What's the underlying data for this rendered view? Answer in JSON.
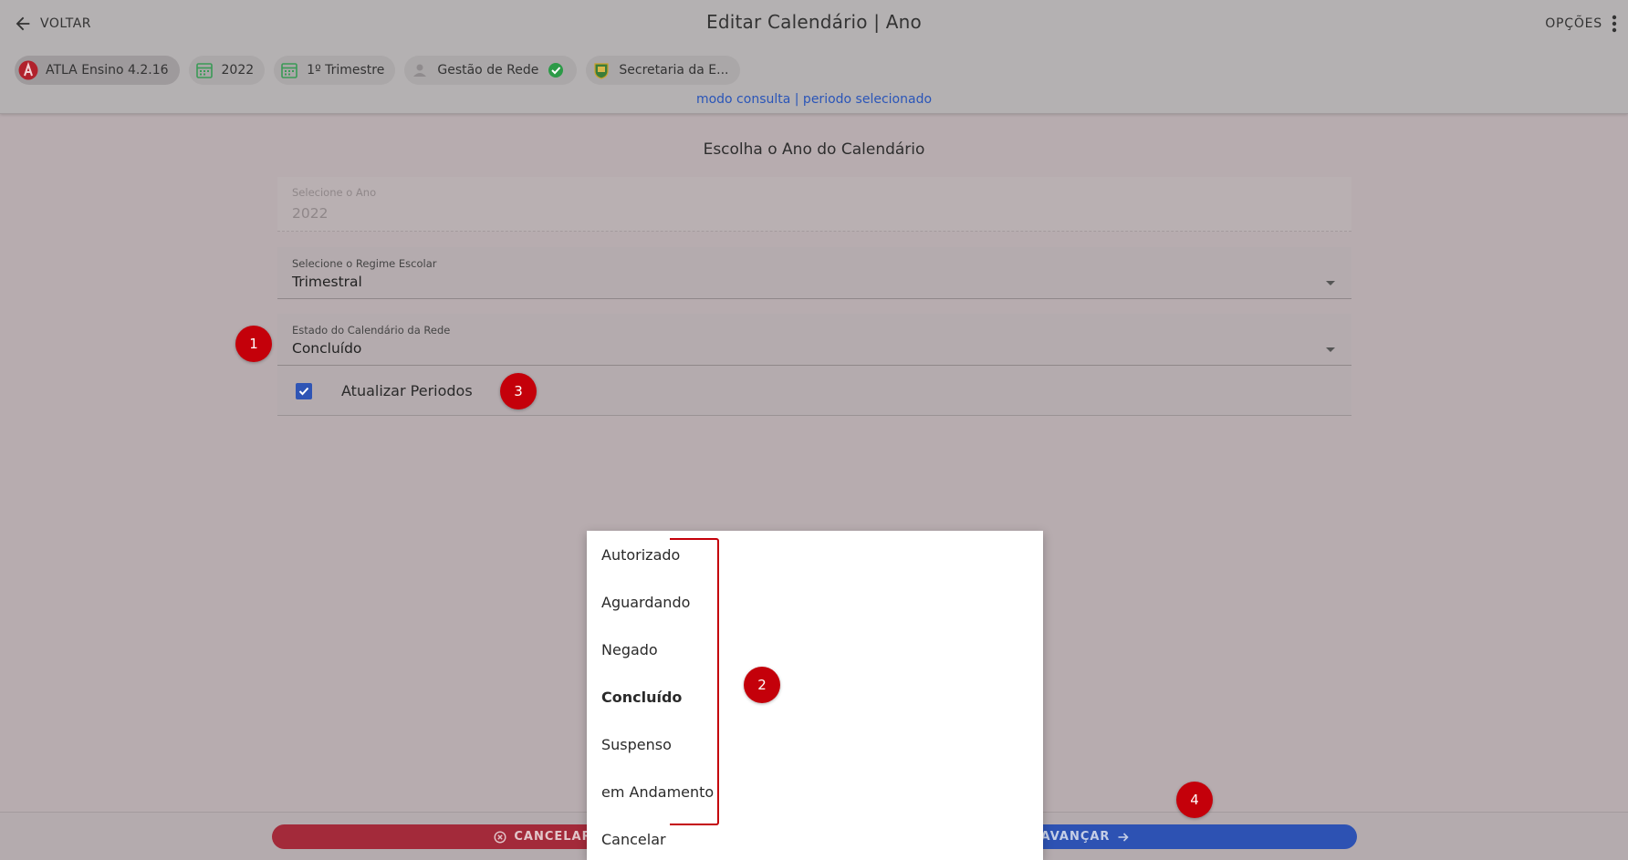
{
  "header": {
    "back_label": "VOLTAR",
    "title": "Editar Calendário | Ano",
    "options_label": "OPÇÕES",
    "chips": [
      {
        "label": "ATLA Ensino 4.2.16",
        "icon": "atla-logo-icon"
      },
      {
        "label": "2022",
        "icon": "calendar-icon"
      },
      {
        "label": "1º Trimestre",
        "icon": "calendar-icon"
      },
      {
        "label": "Gestão de Rede",
        "icon": "person-icon"
      },
      {
        "label": "Secretaria da E...",
        "icon": "crest-icon"
      }
    ],
    "mode_text": "modo consulta | periodo selecionado"
  },
  "form": {
    "section_title": "Escolha o Ano do Calendário",
    "year_field": {
      "label": "Selecione o Ano",
      "value": "2022"
    },
    "regime_field": {
      "label": "Selecione o Regime Escolar",
      "value": "Trimestral"
    },
    "state_field": {
      "label": "Estado do Calendário da Rede",
      "value": "Concluído"
    },
    "update_periods": {
      "label": "Atualizar Periodos",
      "checked": true
    }
  },
  "dropdown": {
    "options": [
      "Autorizado",
      "Aguardando",
      "Negado",
      "Concluído",
      "Suspenso",
      "em Andamento",
      "Cancelar"
    ],
    "selected": "Concluído"
  },
  "footer": {
    "cancel_label": "CANCELAR",
    "advance_label": "AVANÇAR"
  },
  "markers": [
    "1",
    "2",
    "3",
    "4"
  ],
  "colors": {
    "accent_blue": "#2d52b3",
    "danger_red": "#a32a3a",
    "marker_red": "#c4000a",
    "link_blue": "#2a55b8"
  }
}
